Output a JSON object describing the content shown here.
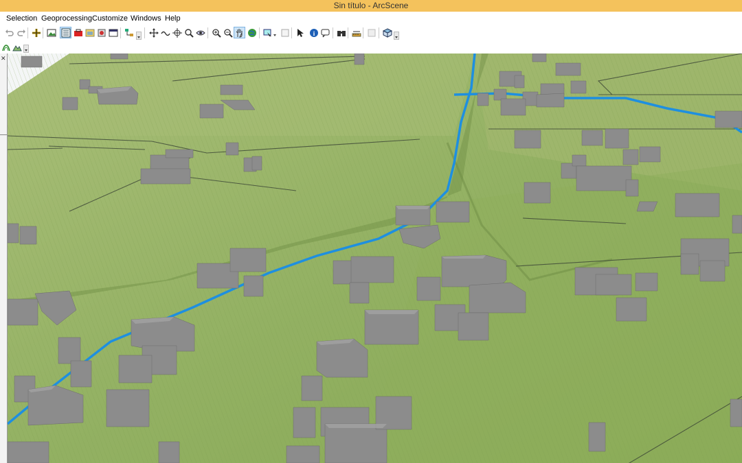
{
  "window": {
    "title": "Sin título - ArcScene"
  },
  "menu": {
    "items": [
      "Selection",
      "Geoprocessing",
      "Customize",
      "Windows",
      "Help"
    ]
  },
  "toolbar": {
    "buttons": [
      "undo-icon",
      "redo-icon",
      "add-data-icon",
      "scene-properties-icon",
      "table-of-contents-icon",
      "arctoolbox-icon",
      "catalog-icon",
      "model-builder-icon",
      "python-icon",
      "navigate-icon",
      "fly-icon",
      "target-center-icon",
      "zoom-to-target-icon",
      "set-observer-icon",
      "zoom-in-icon",
      "zoom-out-icon",
      "pan-icon",
      "full-extent-icon",
      "select-features-icon",
      "clear-selection-icon",
      "select-elements-icon",
      "identify-icon",
      "html-popup-icon",
      "find-icon",
      "measure-icon",
      "animation-icon",
      "3d-effects-icon"
    ],
    "row2": [
      "layer-symbology-icon",
      "terrain-icon"
    ],
    "colors": {
      "active": "#cde4f7",
      "titlebar": "#f4c25c"
    }
  },
  "scene": {
    "description_icon": "3d-scene-view",
    "colors": {
      "terrain": "#9bb56a",
      "terrain_dark": "#7f9a52",
      "river": "#1e8fe0",
      "building": "#8a8a8a"
    }
  }
}
